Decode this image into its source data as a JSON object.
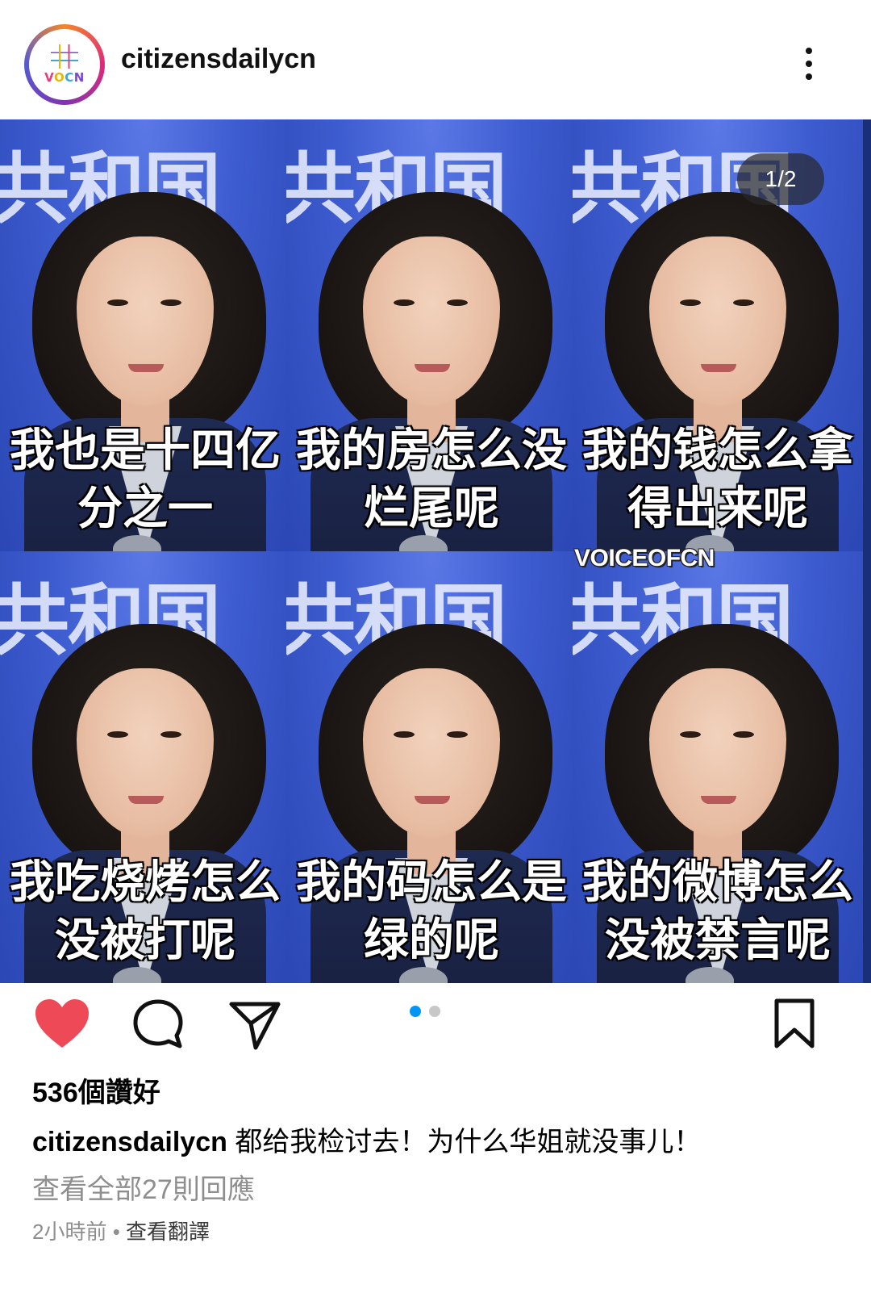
{
  "post": {
    "username": "citizensdailycn",
    "avatar_text": "VOCN",
    "page_counter": "1/2",
    "watermark": "VOICEOFCN",
    "banner_text": "共和国",
    "captions": [
      [
        "我也是十四亿",
        "分之一"
      ],
      [
        "我的房怎么没",
        "烂尾呢"
      ],
      [
        "我的钱怎么拿",
        "得出来呢"
      ],
      [
        "我吃烧烤怎么",
        "没被打呢"
      ],
      [
        "我的码怎么是",
        "绿的呢"
      ],
      [
        "我的微博怎么",
        "没被禁言呢"
      ]
    ],
    "likes": "536個讚好",
    "caption_user": "citizensdailycn",
    "caption_text": "都给我检讨去！为什么华姐就没事儿！",
    "view_comments": "查看全部27則回應",
    "time": "2小時前",
    "separator": "•",
    "translate": "查看翻譯",
    "carousel": {
      "current": 1,
      "total": 2
    }
  },
  "icons": {
    "like": "heart-icon",
    "comment": "comment-icon",
    "share": "send-icon",
    "save": "bookmark-icon",
    "more": "more-vertical-icon"
  },
  "colors": {
    "like_active": "#ed4956",
    "carousel_active": "#0095f6",
    "carousel_inactive": "#c7c7c7",
    "muted_text": "#8e8e8e"
  }
}
